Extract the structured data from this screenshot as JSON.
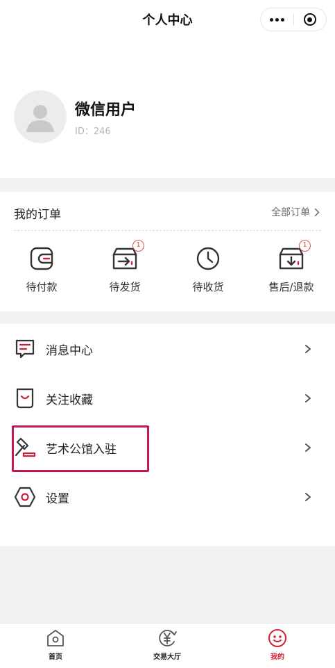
{
  "navbar": {
    "title": "个人中心",
    "more_icon": "more-dots-icon",
    "close_icon": "target-icon"
  },
  "profile": {
    "name": "微信用户",
    "id_text": "ID：246",
    "avatar_icon": "user-avatar-icon"
  },
  "orders": {
    "title": "我的订单",
    "all_label": "全部订单",
    "items": [
      {
        "label": "待付款",
        "icon": "wallet-icon",
        "badge": ""
      },
      {
        "label": "待发货",
        "icon": "ship-box-icon",
        "badge": "1"
      },
      {
        "label": "待收货",
        "icon": "clock-icon",
        "badge": ""
      },
      {
        "label": "售后/退款",
        "icon": "return-box-icon",
        "badge": "1"
      }
    ]
  },
  "menu": {
    "items": [
      {
        "label": "消息中心",
        "icon": "message-icon"
      },
      {
        "label": "关注收藏",
        "icon": "favorite-icon"
      },
      {
        "label": "艺术公馆入驻",
        "icon": "gavel-icon"
      },
      {
        "label": "设置",
        "icon": "settings-icon"
      }
    ]
  },
  "tabbar": {
    "items": [
      {
        "label": "首页",
        "icon": "home-icon",
        "active": false
      },
      {
        "label": "交易大厅",
        "icon": "yuan-exchange-icon",
        "active": false
      },
      {
        "label": "我的",
        "icon": "smiley-icon",
        "active": true
      }
    ]
  },
  "colors": {
    "accent": "#d41f38",
    "highlight_border": "#c2185b",
    "badge": "#d9534f",
    "page_bg": "#f2f2f2"
  }
}
